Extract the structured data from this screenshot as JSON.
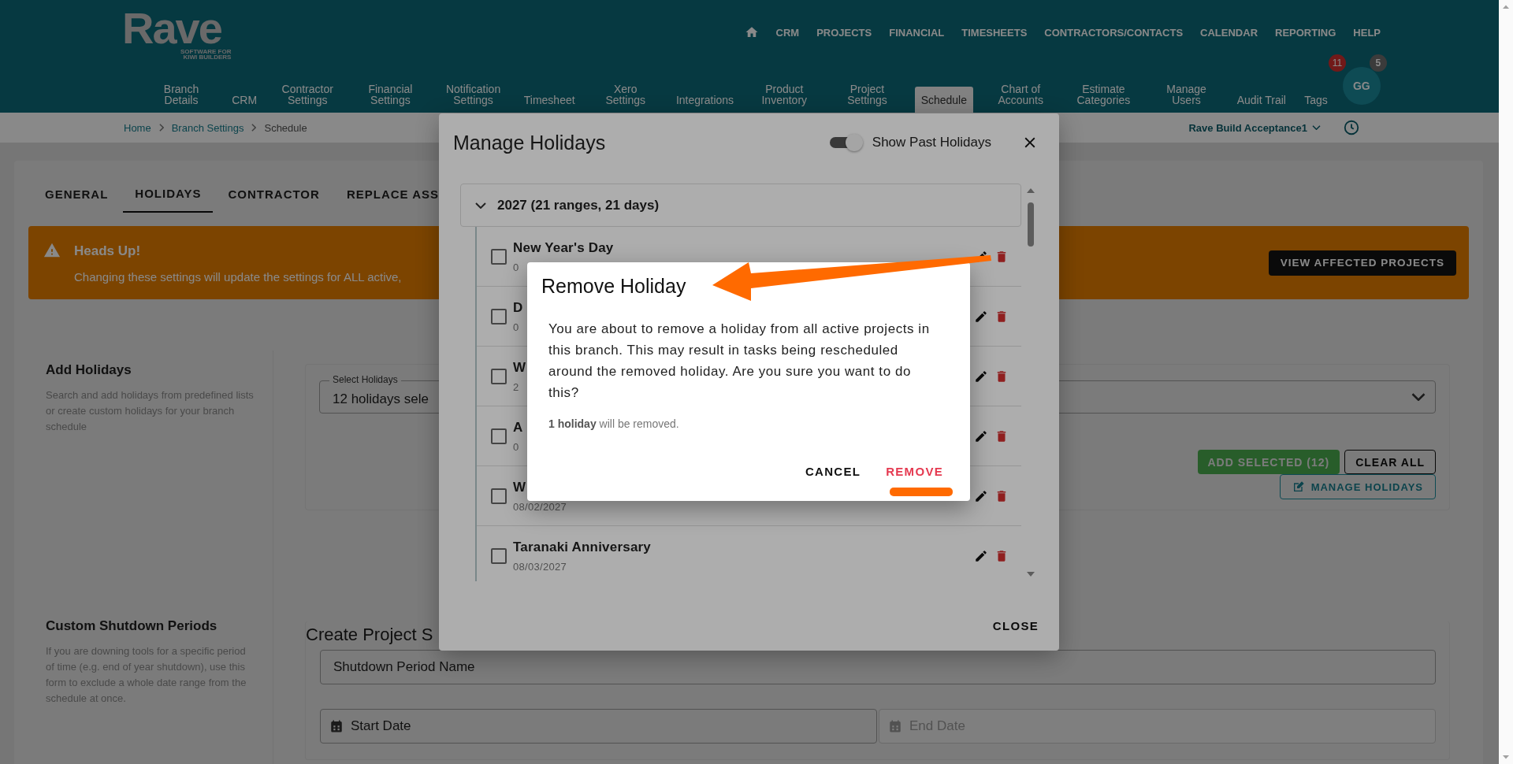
{
  "header": {
    "logo": "Rave",
    "logo_tagline": [
      "SOFTWARE FOR",
      "KIWI BUILDERS"
    ],
    "top_nav": [
      "CRM",
      "PROJECTS",
      "FINANCIAL",
      "TIMESHEETS",
      "CONTRACTORS/CONTACTS",
      "CALENDAR",
      "REPORTING",
      "HELP"
    ],
    "settings_nav": [
      {
        "label": "Branch Details",
        "selected": false
      },
      {
        "label": "CRM",
        "selected": false
      },
      {
        "label": "Contractor Settings",
        "selected": false
      },
      {
        "label": "Financial Settings",
        "selected": false
      },
      {
        "label": "Notification Settings",
        "selected": false
      },
      {
        "label": "Timesheet",
        "selected": false
      },
      {
        "label": "Xero Settings",
        "selected": false
      },
      {
        "label": "Integrations",
        "selected": false
      },
      {
        "label": "Product Inventory",
        "selected": false
      },
      {
        "label": "Project Settings",
        "selected": false
      },
      {
        "label": "Schedule",
        "selected": true
      },
      {
        "label": "Chart of Accounts",
        "selected": false
      },
      {
        "label": "Estimate Categories",
        "selected": false
      },
      {
        "label": "Manage Users",
        "selected": false
      },
      {
        "label": "Audit Trail",
        "selected": false
      },
      {
        "label": "Tags",
        "selected": false
      }
    ],
    "avatar": {
      "initials": "GG",
      "badges": [
        {
          "count": "11",
          "kind": "alert"
        },
        {
          "count": "5",
          "kind": "count"
        }
      ]
    }
  },
  "breadcrumbs": [
    {
      "label": "Home",
      "kind": "link"
    },
    {
      "label": "Branch Settings",
      "kind": "link"
    },
    {
      "label": "Schedule",
      "kind": "current"
    }
  ],
  "branch_selector": "Rave Build Acceptance1",
  "page_tabs": [
    {
      "label": "GENERAL",
      "selected": false
    },
    {
      "label": "HOLIDAYS",
      "selected": true
    },
    {
      "label": "CONTRACTOR",
      "selected": false
    },
    {
      "label": "REPLACE ASS",
      "selected": false
    }
  ],
  "alert": {
    "title": "Heads Up!",
    "message": "Changing these settings will update the settings for ALL active,",
    "button": "VIEW AFFECTED PROJECTS"
  },
  "add_holidays": {
    "title": "Add Holidays",
    "description": "Search and add holidays from predefined lists or create custom holidays for your branch schedule",
    "select_field": {
      "label": "Select Holidays",
      "value": "12 holidays sele"
    },
    "buttons": [
      {
        "label": "ADD SELECTED (12)",
        "kind": "contained"
      },
      {
        "label": "CLEAR ALL",
        "kind": "outlined"
      }
    ],
    "manage_button": "MANAGE HOLIDAYS"
  },
  "shutdown": {
    "title": "Custom Shutdown Periods",
    "description": "If you are downing tools for a specific period of time (e.g. end of year shutdown), use this form to exclude a whole date range from the schedule at once.",
    "form_title": "Create Project S",
    "fields": [
      {
        "placeholder": "Shutdown Period Name",
        "kind": "text",
        "disabled": false
      },
      {
        "placeholder": "Start Date",
        "kind": "date",
        "disabled": false
      },
      {
        "placeholder": "End Date",
        "kind": "date",
        "disabled": true
      }
    ]
  },
  "manage_dialog": {
    "title": "Manage Holidays",
    "show_past": {
      "label": "Show Past Holidays",
      "on": true
    },
    "group": {
      "label": "2027 (21 ranges, 21 days)",
      "expanded": true,
      "rows": [
        {
          "name": "New Year's Day",
          "date": "0",
          "checked": false
        },
        {
          "name": "D",
          "date": "0",
          "checked": false
        },
        {
          "name": "W",
          "date": "2",
          "checked": false
        },
        {
          "name": "A",
          "date": "0",
          "checked": false
        },
        {
          "name": "W",
          "date": "08/02/2027",
          "checked": false
        },
        {
          "name": "Taranaki Anniversary",
          "date": "08/03/2027",
          "checked": false
        }
      ]
    },
    "close_button": "CLOSE"
  },
  "confirm_dialog": {
    "title": "Remove Holiday",
    "message": "You are about to remove a holiday from all active projects in this branch. This may result in tasks being rescheduled around the removed holiday. Are you sure you want to do this?",
    "note": "**1 holiday** will be removed.",
    "buttons": [
      {
        "label": "CANCEL",
        "kind": "text"
      },
      {
        "label": "REMOVE",
        "kind": "danger"
      }
    ]
  }
}
